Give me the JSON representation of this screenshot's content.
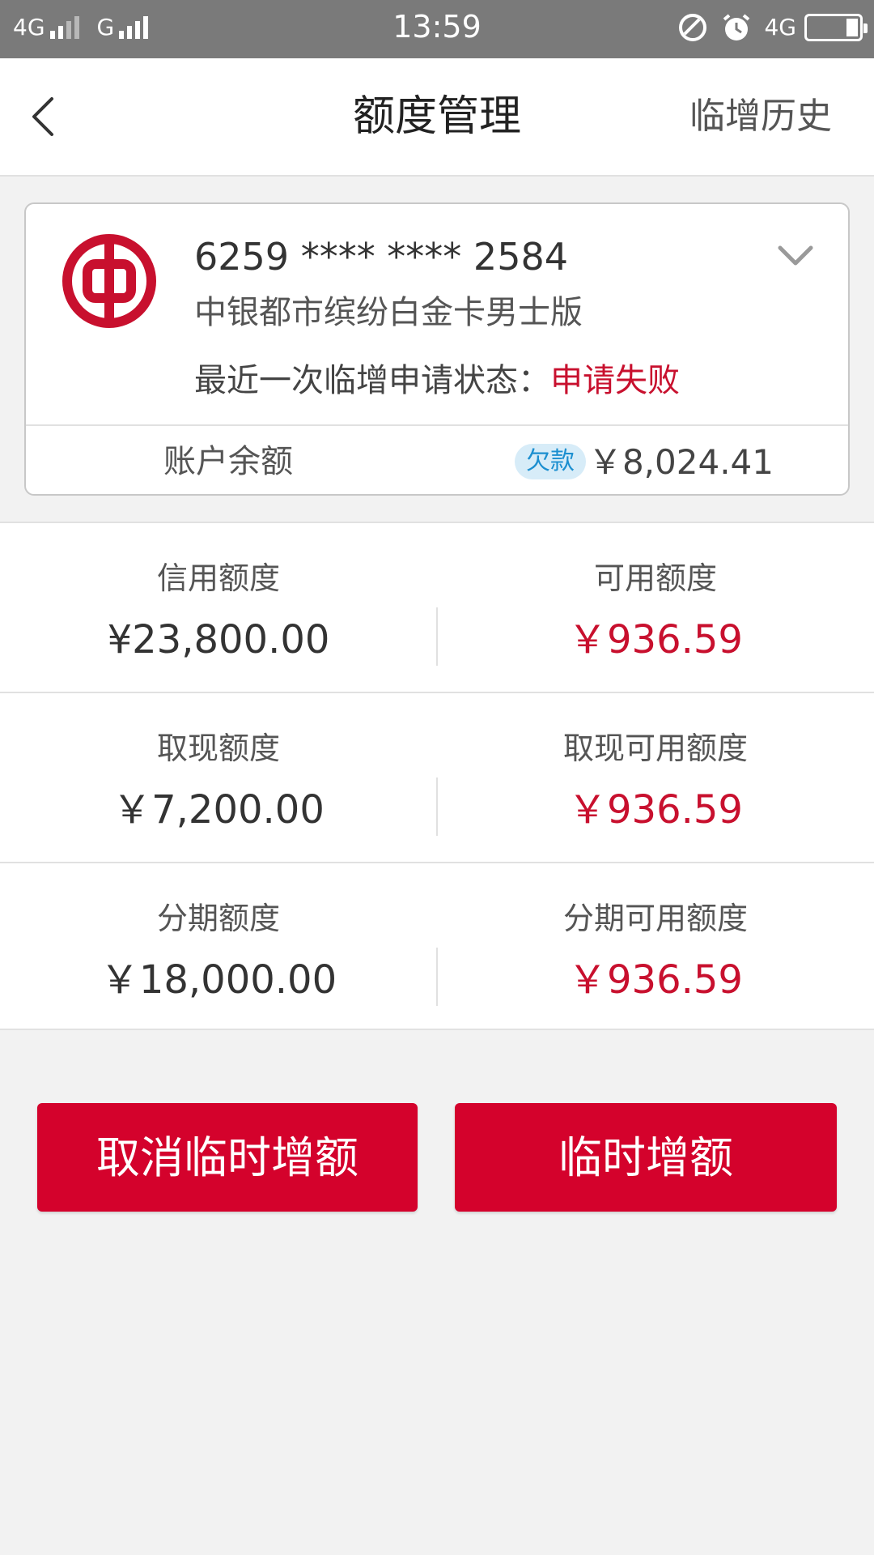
{
  "status_bar": {
    "network_left": "4G",
    "network_left2": "G",
    "time": "13:59",
    "network_right": "4G"
  },
  "nav": {
    "title": "额度管理",
    "right_link": "临增历史"
  },
  "card": {
    "number": "6259 **** **** 2584",
    "name": "中银都市缤纷白金卡男士版",
    "status_label": "最近一次临增申请状态：",
    "status_value": "申请失败",
    "balance_label": "账户余额",
    "balance_badge": "欠款",
    "balance_value": "￥8,024.41"
  },
  "limits": [
    {
      "left_label": "信用额度",
      "left_value": "¥23,800.00",
      "right_label": "可用额度",
      "right_value": "￥936.59"
    },
    {
      "left_label": "取现额度",
      "left_value": "￥7,200.00",
      "right_label": "取现可用额度",
      "right_value": "￥936.59"
    },
    {
      "left_label": "分期额度",
      "left_value": "￥18,000.00",
      "right_label": "分期可用额度",
      "right_value": "￥936.59"
    }
  ],
  "buttons": {
    "cancel": "取消临时增额",
    "increase": "临时增额"
  },
  "colors": {
    "accent_red": "#d4022c",
    "status_red": "#c8102e",
    "badge_bg": "#d7ecf8",
    "badge_text": "#1c8fd0"
  },
  "icons": {
    "back": "chevron-left-icon",
    "logo": "bank-of-china-logo",
    "expand": "chevron-down-icon"
  }
}
